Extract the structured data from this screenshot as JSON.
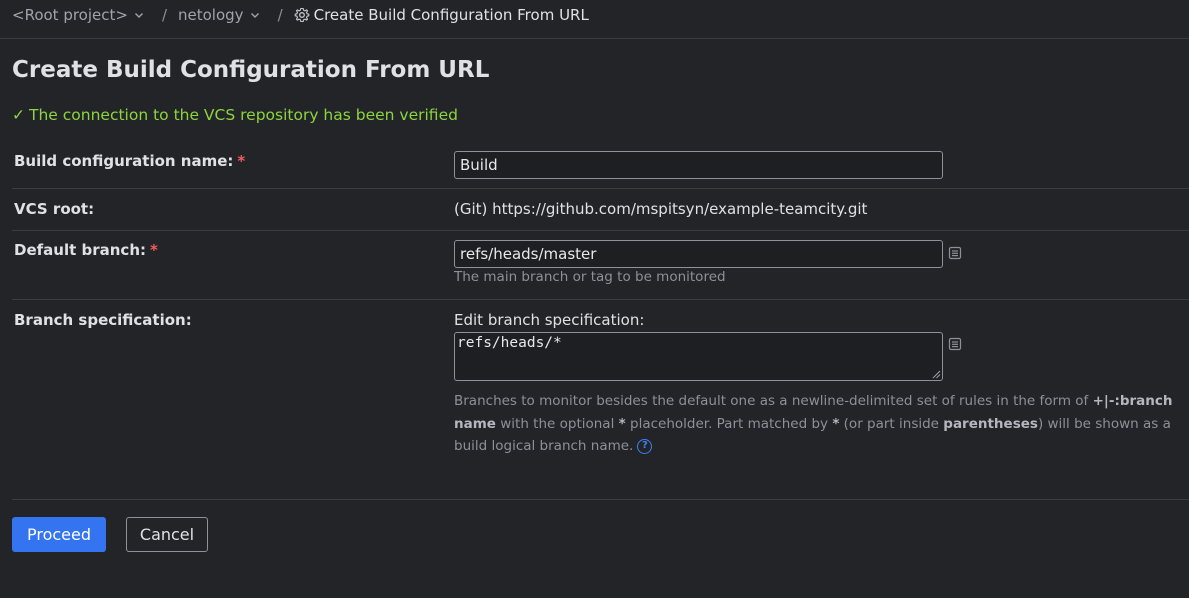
{
  "breadcrumb": {
    "items": [
      {
        "label": "<Root project>"
      },
      {
        "label": "netology"
      }
    ],
    "separator": "/",
    "current": "Create Build Configuration From URL"
  },
  "page": {
    "title": "Create Build Configuration From URL",
    "verified_message": "The connection to the VCS repository has been verified",
    "verified_check": "✓"
  },
  "form": {
    "required_mark": "*",
    "build_name": {
      "label": "Build configuration name:",
      "value": "Build"
    },
    "vcs_root": {
      "label": "VCS root:",
      "value": "(Git) https://github.com/mspitsyn/example-teamcity.git"
    },
    "default_branch": {
      "label": "Default branch:",
      "value": "refs/heads/master",
      "hint": "The main branch or tag to be monitored"
    },
    "branch_spec": {
      "label": "Branch specification:",
      "edit_label": "Edit branch specification:",
      "value": "refs/heads/*",
      "desc_part1": "Branches to monitor besides the default one as a newline-delimited set of rules in the form of ",
      "desc_bold1": "+|-:branch name",
      "desc_part2": " with the optional ",
      "desc_bold2": "*",
      "desc_part3": " placeholder. Part matched by ",
      "desc_bold3": "*",
      "desc_part4": " (or part inside ",
      "desc_bold4": "parentheses",
      "desc_part5": ") will be shown as a build logical branch name.",
      "help_glyph": "?"
    }
  },
  "actions": {
    "proceed_label": "Proceed",
    "cancel_label": "Cancel"
  },
  "colors": {
    "background": "#232428",
    "accent": "#3574f0",
    "success": "#8bd63d",
    "required": "#f05c5c"
  }
}
